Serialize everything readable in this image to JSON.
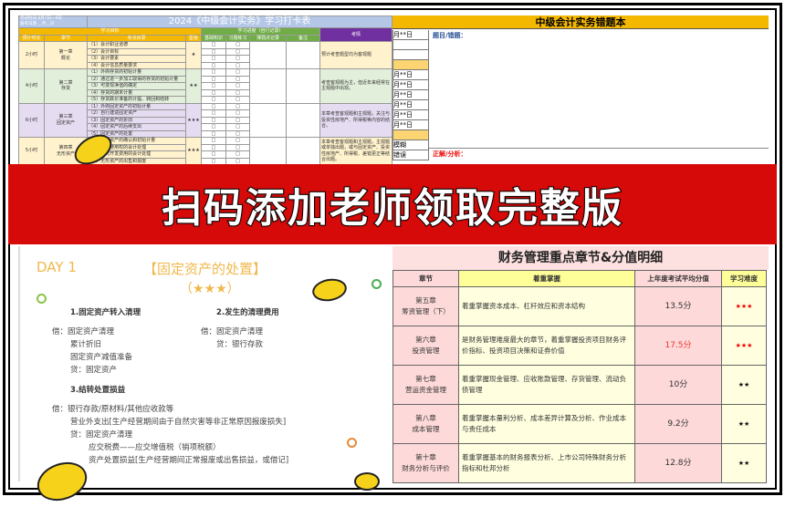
{
  "checkin_table": {
    "exam_time": "考试时间 9月7日—9日",
    "prep_date": "备考日期 __月__日",
    "title": "2024《中级会计实务》学习打卡表",
    "group_goal": "学习目标",
    "group_progress": "学习进度（自行记录）",
    "col_situation": "考情",
    "columns": [
      "预计时长",
      "章节",
      "考点目录",
      "星级",
      "基础知识",
      "习题练习",
      "薄弱点记录",
      "备注"
    ],
    "rows": [
      {
        "hours": "2小时",
        "chapter": "第一章",
        "chapter_name": "概论",
        "points": [
          "（1）会计职业道德",
          "（2）会计目标",
          "（3）会计要素",
          "（4）会计信息质量要求"
        ],
        "stars": "★",
        "note": "预计考查题型均为客观题",
        "color": "y"
      },
      {
        "hours": "4小时",
        "chapter": "第二章",
        "chapter_name": "存货",
        "points": [
          "（1）外购存货的初始计量",
          "（2）通过进一步加工取得的存货的初始计量",
          "（3）可变现净值的确定",
          "（4）存货的期末计量",
          "（5）存货跌价准备的计提、转回和结转"
        ],
        "stars": "★★",
        "note": "考查客观题为主，但近年来经常在主观题中出现。",
        "color": "g"
      },
      {
        "hours": "6小时",
        "chapter": "第三章",
        "chapter_name": "固定资产",
        "points": [
          "（1）外购固定资产的初始计量",
          "（2）自行建造固定资产",
          "（3）固定资产的折旧",
          "（4）固定资产的后续支出",
          "（5）固定资产的处置"
        ],
        "stars": "★★★",
        "note": "本章考查客观题和主观题，关注与投资性房地产、所得税等内容的结合。",
        "color": "p"
      },
      {
        "hours": "5小时",
        "chapter": "第四章",
        "chapter_name": "无形资产",
        "points": [
          "（1）无形资产的确认和初始计量",
          "（2）土地使用权的会计处理",
          "（3）研究开发费用的会计处理",
          "（4）无形资产的出售和报废"
        ],
        "stars": "★★★",
        "note": "本章考查客观题和主观题，主观题或单独出题，或与固定资产、投资性房地产、所得税、差错更正等结合出题。",
        "color": "y"
      }
    ]
  },
  "error_book": {
    "title": "中级会计实务错题本",
    "question_label": "题目/错题：",
    "answer_label": "正解/分析：",
    "date_cells": [
      "月**日",
      "月**日",
      "月**日",
      "月**日",
      "月**日",
      "月**日",
      "月**日"
    ],
    "tags": [
      "模糊",
      "错误"
    ]
  },
  "banner": {
    "text": "扫码添加老师领取完整版"
  },
  "notes": {
    "day": "DAY 1",
    "title": "【固定资产的处置】",
    "stars": "（★★★）",
    "s1": "1.固定资产转入清理",
    "s1_lines": [
      "借：固定资产清理",
      "累计折旧",
      "固定资产减值准备",
      "贷：固定资产"
    ],
    "s2": "2.发生的清理费用",
    "s2_lines": [
      "借：固定资产清理",
      "贷：银行存款"
    ],
    "s3": "3.结转处置损益",
    "s3_lines": [
      "借：银行存款/原材料/其他应收款等",
      "营业外支出[生产经营期间由于自然灾害等非正常原因报废损失]",
      "贷：固定资产清理",
      "应交税费——应交增值税（销项税额）",
      "资产处置损益[生产经营期间正常报废或出售损益，或借记]"
    ]
  },
  "finance": {
    "title": "财务管理重点章节&分值明细",
    "headers": [
      "章节",
      "着重掌握",
      "上年度考试平均分值",
      "学习难度"
    ],
    "rows": [
      {
        "chapter": "第五章",
        "name": "筹资管理（下）",
        "focus": "着重掌握资本成本、杠杆效应和资本结构",
        "score": "13.5分",
        "difficulty": "★★★",
        "hot": false,
        "red_stars": true
      },
      {
        "chapter": "第六章",
        "name": "投资管理",
        "focus": "是财务管理难度最大的章节，着重掌握投资项目财务评价指标、投资项目决策和证券价值",
        "score": "17.5分",
        "difficulty": "★★★",
        "hot": true,
        "red_stars": true
      },
      {
        "chapter": "第七章",
        "name": "营运资金管理",
        "focus": "着重掌握现金管理、应收账款管理、存货管理、流动负债管理",
        "score": "10分",
        "difficulty": "★★",
        "hot": false,
        "red_stars": false
      },
      {
        "chapter": "第八章",
        "name": "成本管理",
        "focus": "着重掌握本量利分析、成本差异计算及分析、作业成本与责任成本",
        "score": "9.2分",
        "difficulty": "★★",
        "hot": false,
        "red_stars": false
      },
      {
        "chapter": "第十章",
        "name": "财务分析与评价",
        "focus": "着重掌握基本的财务报表分析、上市公司特殊财务分析指标和杜邦分析",
        "score": "12.8分",
        "difficulty": "★★",
        "hot": false,
        "red_stars": false
      }
    ]
  }
}
